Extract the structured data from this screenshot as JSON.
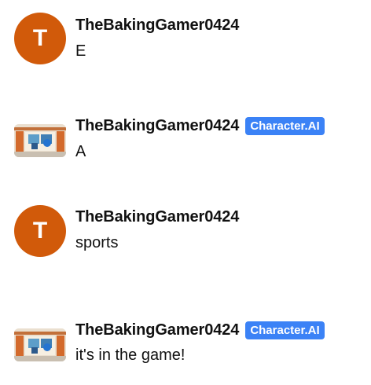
{
  "messages": [
    {
      "username": "TheBakingGamer0424",
      "avatar_letter": "T",
      "text": "E",
      "badge": ""
    },
    {
      "username": "TheBakingGamer0424",
      "avatar_letter": "",
      "text": "A",
      "badge": "Character.AI"
    },
    {
      "username": "TheBakingGamer0424",
      "avatar_letter": "T",
      "text": "sports",
      "badge": ""
    },
    {
      "username": "TheBakingGamer0424",
      "avatar_letter": "",
      "text": "it's in the game!",
      "badge": "Character.AI"
    }
  ],
  "colors": {
    "avatar_bg": "#d15a0a",
    "badge_bg": "#3b82f6",
    "text": "#111111"
  },
  "icons": {
    "character_avatar": "character-image-avatar-icon"
  }
}
